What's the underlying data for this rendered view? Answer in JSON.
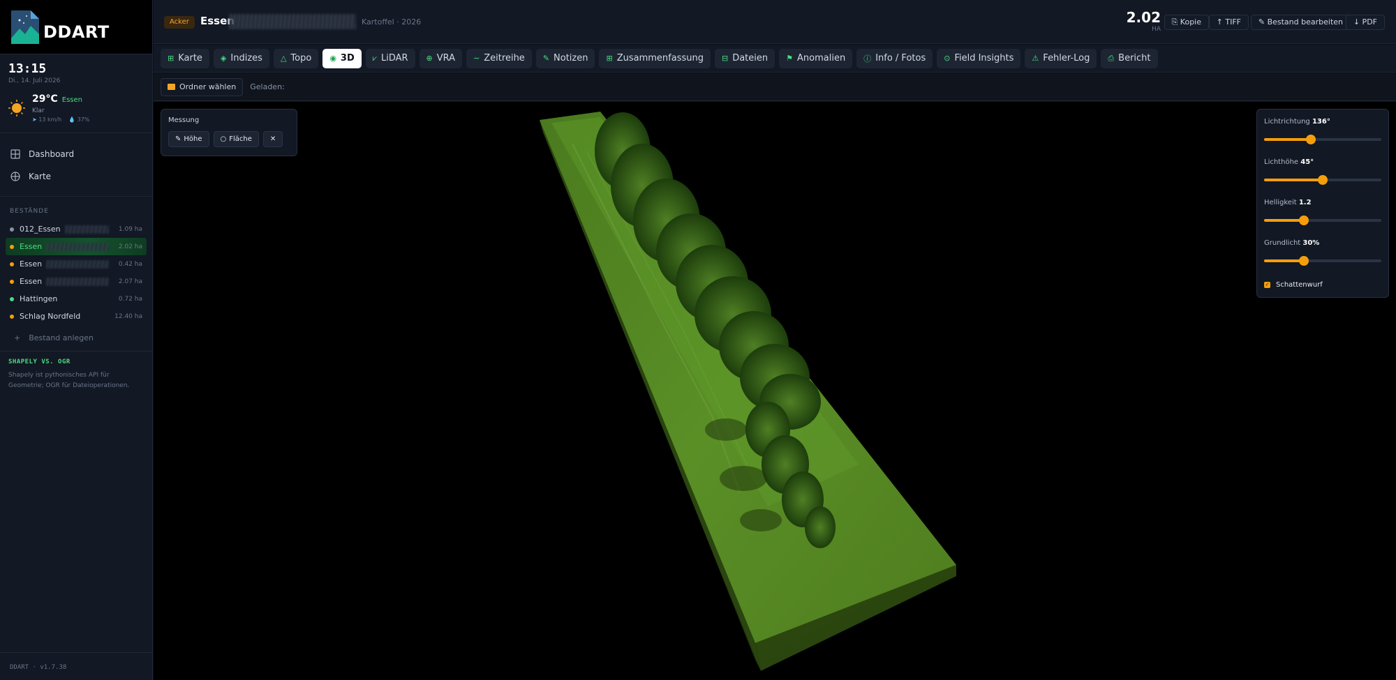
{
  "app": {
    "name": "DDART",
    "version": "DDART · v1.7.38"
  },
  "clock": {
    "time": "13:15",
    "date": "Di., 14. Juli 2026"
  },
  "weather": {
    "temp": "29°C",
    "city": "Essen",
    "condition": "Klar",
    "wind": "13 km/h",
    "humidity": "37%"
  },
  "nav": [
    {
      "label": "Dashboard",
      "icon": "grid-icon"
    },
    {
      "label": "Karte",
      "icon": "globe-icon"
    }
  ],
  "stands_title": "BESTÄNDE",
  "stands": [
    {
      "name": "012_Essen",
      "area": "1.09 ha",
      "color": "#8a93a6",
      "active": false
    },
    {
      "name": "Essen",
      "area": "2.02 ha",
      "color": "#f59e0b",
      "active": true
    },
    {
      "name": "Essen",
      "area": "0.42 ha",
      "color": "#f59e0b",
      "active": false
    },
    {
      "name": "Essen",
      "area": "2.07 ha",
      "color": "#f59e0b",
      "active": false
    },
    {
      "name": "Hattingen",
      "area": "0.72 ha",
      "color": "#4ade80",
      "active": false
    },
    {
      "name": "Schlag Nordfeld",
      "area": "12.40 ha",
      "color": "#f59e0b",
      "active": false
    }
  ],
  "add_stand": "Bestand anlegen",
  "tip": {
    "title": "SHAPELY VS. OGR",
    "text": "Shapely ist pythonisches API für Geometrie; OGR für Dateioperationen."
  },
  "header": {
    "badge": "Acker",
    "title": "Essen",
    "subtitle": "Kartoffel · 2026",
    "area_value": "2.02",
    "area_unit": "HA",
    "buttons": [
      "⎘ Kopie",
      "↑ TIFF",
      "✎ Bestand bearbeiten",
      "↓ PDF"
    ]
  },
  "tabs": [
    {
      "label": "Karte",
      "icon": "⊞",
      "active": false
    },
    {
      "label": "Indizes",
      "icon": "◈",
      "active": false
    },
    {
      "label": "Topo",
      "icon": "△",
      "active": false
    },
    {
      "label": "3D",
      "icon": "◉",
      "active": true
    },
    {
      "label": "LiDAR",
      "icon": "⩗",
      "active": false
    },
    {
      "label": "VRA",
      "icon": "⊕",
      "active": false
    },
    {
      "label": "Zeitreihe",
      "icon": "∼",
      "active": false
    },
    {
      "label": "Notizen",
      "icon": "✎",
      "active": false
    },
    {
      "label": "Zusammenfassung",
      "icon": "⊞",
      "active": false
    },
    {
      "label": "Dateien",
      "icon": "⊟",
      "active": false
    },
    {
      "label": "Anomalien",
      "icon": "⚑",
      "active": false
    },
    {
      "label": "Info / Fotos",
      "icon": "ⓘ",
      "active": false
    },
    {
      "label": "Field Insights",
      "icon": "⊙",
      "active": false
    },
    {
      "label": "Fehler-Log",
      "icon": "⚠",
      "active": false
    },
    {
      "label": "Bericht",
      "icon": "⎙",
      "active": false
    }
  ],
  "toolbar": {
    "folder_button": "Ordner wählen",
    "loaded_label": "Geladen:"
  },
  "measure": {
    "title": "Messung",
    "height_button": "Höhe",
    "area_button": "Fläche",
    "close": "✕"
  },
  "lighting": {
    "direction": {
      "label": "Lichtrichtung",
      "value": "136°",
      "fraction": 0.4
    },
    "height": {
      "label": "Lichthöhe",
      "value": "45°",
      "fraction": 0.5
    },
    "brightness": {
      "label": "Helligkeit",
      "value": "1.2",
      "fraction": 0.34
    },
    "ambient": {
      "label": "Grundlicht",
      "value": "30%",
      "fraction": 0.34
    },
    "shadow": {
      "label": "Schattenwurf",
      "checked": true
    }
  }
}
